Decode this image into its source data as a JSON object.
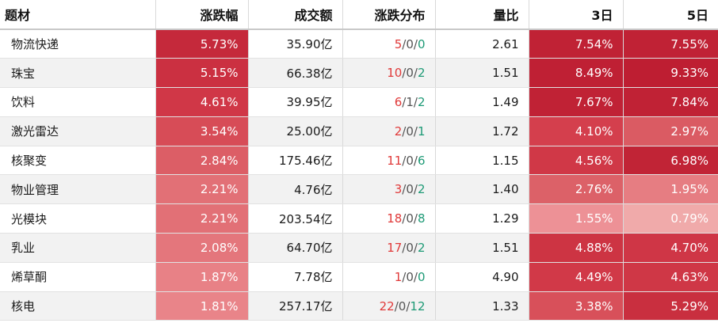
{
  "headers": {
    "theme": "题材",
    "change": "涨跌幅",
    "turnover": "成交额",
    "distribution": "涨跌分布",
    "volume_ratio": "量比",
    "d3": "3日",
    "d5": "5日"
  },
  "colors": {
    "up": "#e03a3a",
    "down": "#1e9a76",
    "flat": "#555555"
  },
  "rows": [
    {
      "name": "物流快递",
      "change": "5.73%",
      "change_value": 5.73,
      "turnover": "35.90亿",
      "up": "5",
      "flat": "0",
      "down": "0",
      "ratio": "2.61",
      "d3": "7.54%",
      "d3_value": 7.54,
      "d5": "7.55%",
      "d5_value": 7.55
    },
    {
      "name": "珠宝",
      "change": "5.15%",
      "change_value": 5.15,
      "turnover": "66.38亿",
      "up": "10",
      "flat": "0",
      "down": "2",
      "ratio": "1.51",
      "d3": "8.49%",
      "d3_value": 8.49,
      "d5": "9.33%",
      "d5_value": 9.33
    },
    {
      "name": "饮料",
      "change": "4.61%",
      "change_value": 4.61,
      "turnover": "39.95亿",
      "up": "6",
      "flat": "1",
      "down": "2",
      "ratio": "1.49",
      "d3": "7.67%",
      "d3_value": 7.67,
      "d5": "7.84%",
      "d5_value": 7.84
    },
    {
      "name": "激光雷达",
      "change": "3.54%",
      "change_value": 3.54,
      "turnover": "25.00亿",
      "up": "2",
      "flat": "0",
      "down": "1",
      "ratio": "1.72",
      "d3": "4.10%",
      "d3_value": 4.1,
      "d5": "2.97%",
      "d5_value": 2.97
    },
    {
      "name": "核聚变",
      "change": "2.84%",
      "change_value": 2.84,
      "turnover": "175.46亿",
      "up": "11",
      "flat": "0",
      "down": "6",
      "ratio": "1.15",
      "d3": "4.56%",
      "d3_value": 4.56,
      "d5": "6.98%",
      "d5_value": 6.98
    },
    {
      "name": "物业管理",
      "change": "2.21%",
      "change_value": 2.21,
      "turnover": "4.76亿",
      "up": "3",
      "flat": "0",
      "down": "2",
      "ratio": "1.40",
      "d3": "2.76%",
      "d3_value": 2.76,
      "d5": "1.95%",
      "d5_value": 1.95
    },
    {
      "name": "光模块",
      "change": "2.21%",
      "change_value": 2.21,
      "turnover": "203.54亿",
      "up": "18",
      "flat": "0",
      "down": "8",
      "ratio": "1.29",
      "d3": "1.55%",
      "d3_value": 1.55,
      "d5": "0.79%",
      "d5_value": 0.79
    },
    {
      "name": "乳业",
      "change": "2.08%",
      "change_value": 2.08,
      "turnover": "64.70亿",
      "up": "17",
      "flat": "0",
      "down": "2",
      "ratio": "1.51",
      "d3": "4.88%",
      "d3_value": 4.88,
      "d5": "4.70%",
      "d5_value": 4.7
    },
    {
      "name": "烯草酮",
      "change": "1.87%",
      "change_value": 1.87,
      "turnover": "7.78亿",
      "up": "1",
      "flat": "0",
      "down": "0",
      "ratio": "4.90",
      "d3": "4.49%",
      "d3_value": 4.49,
      "d5": "4.63%",
      "d5_value": 4.63
    },
    {
      "name": "核电",
      "change": "1.81%",
      "change_value": 1.81,
      "turnover": "257.17亿",
      "up": "22",
      "flat": "0",
      "down": "12",
      "ratio": "1.33",
      "d3": "3.38%",
      "d3_value": 3.38,
      "d5": "5.29%",
      "d5_value": 5.29
    }
  ]
}
